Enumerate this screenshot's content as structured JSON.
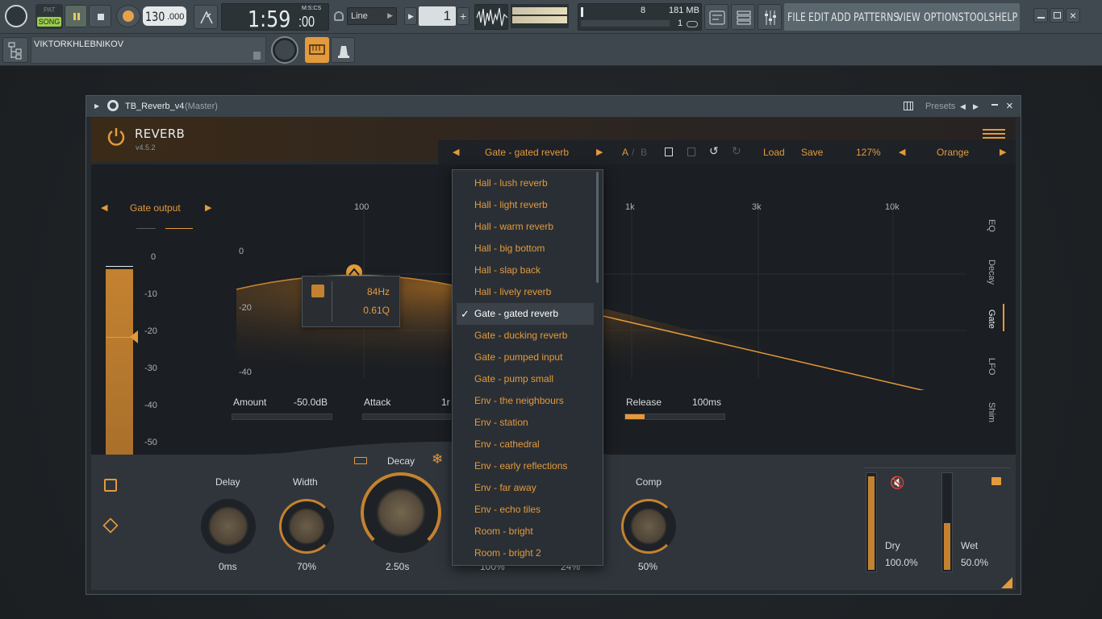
{
  "toolbar": {
    "pat_label": "PAT",
    "song_label": "SONG",
    "tempo": "130",
    "tempo_frac": ".000",
    "time": "1:59",
    "time_frac": ":00",
    "time_format": "M:S:CS",
    "snap": "Line",
    "pattern_num": "1",
    "cpu_voices": "8",
    "memory": "181 MB",
    "voices2": "1",
    "menu": [
      "FILE",
      "EDIT",
      "ADD",
      "PATTERNS",
      "VIEW",
      "OPTIONS",
      "TOOLS",
      "HELP"
    ],
    "hint_text": "VIKTORKHLEBNIKOV"
  },
  "window": {
    "title": "TB_Reverb_v4",
    "subtitle": "(Master)",
    "presets_label": "Presets"
  },
  "plugin": {
    "name": "REVERB",
    "version": "v4.5.2",
    "preset": "Gate - gated reverb",
    "ab_a": "A",
    "ab_b": "B",
    "load": "Load",
    "save": "Save",
    "zoom": "127%",
    "theme": "Orange",
    "accent": "#e39a3c"
  },
  "gate": {
    "output_label": "Gate output",
    "meter_scale": [
      "0",
      "-10",
      "-20",
      "-30",
      "-40",
      "-50"
    ],
    "freq_labels": [
      "100",
      "1k",
      "3k",
      "10k"
    ],
    "db_labels": [
      "0",
      "-20",
      "-40"
    ],
    "tooltip_freq": "84Hz",
    "tooltip_q": "0.61Q",
    "amount_label": "Amount",
    "amount_value": "-50.0dB",
    "attack_label": "Attack",
    "attack_value": "1r",
    "release_label": "Release",
    "release_value": "100ms"
  },
  "side_tabs": [
    "EQ",
    "Decay",
    "Gate",
    "LFO",
    "Shim"
  ],
  "knobs": {
    "delay_label": "Delay",
    "delay_value": "0ms",
    "width_label": "Width",
    "width_value": "70%",
    "decay_label": "Decay",
    "decay_value": "2.50s",
    "hidden1_value": "100%",
    "hidden2_value": "24%",
    "comp_label": "Comp",
    "comp_value": "50%",
    "dry_label": "Dry",
    "dry_value": "100.0%",
    "wet_label": "Wet",
    "wet_value": "50.0%"
  },
  "presets_list": [
    "Hall - lush reverb",
    "Hall - light reverb",
    "Hall - warm reverb",
    "Hall - big bottom",
    "Hall - slap back",
    "Hall - lively reverb",
    "Gate - gated reverb",
    "Gate - ducking reverb",
    "Gate - pumped input",
    "Gate - pump small",
    "Env - the neighbours",
    "Env - station",
    "Env - cathedral",
    "Env - early reflections",
    "Env - far away",
    "Env - echo  tiles",
    "Room - bright",
    "Room - bright 2"
  ],
  "selected_preset_index": 6
}
